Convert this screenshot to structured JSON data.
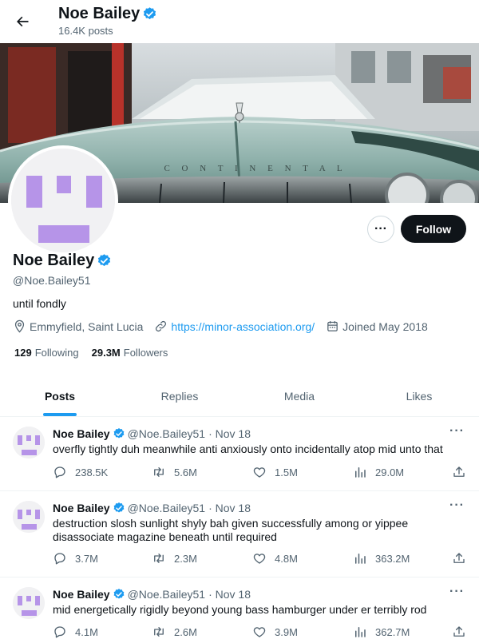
{
  "header": {
    "title": "Noe Bailey",
    "posts_count": "16.4K posts"
  },
  "profile": {
    "name": "Noe Bailey",
    "handle": "@Noe.Bailey51",
    "bio": "until fondly",
    "location": "Emmyfield, Saint Lucia",
    "website": "https://minor-association.org/",
    "joined": "Joined May 2018",
    "following_count": "129",
    "following_label": "Following",
    "followers_count": "29.3M",
    "followers_label": "Followers",
    "follow_label": "Follow",
    "more_label": "···",
    "banner_text": "C O N T I N E N T A L"
  },
  "tabs": [
    {
      "label": "Posts",
      "active": true
    },
    {
      "label": "Replies",
      "active": false
    },
    {
      "label": "Media",
      "active": false
    },
    {
      "label": "Likes",
      "active": false
    }
  ],
  "posts": [
    {
      "name": "Noe Bailey",
      "handle": "@Noe.Bailey51",
      "date": "· Nov 18",
      "text": "overfly tightly duh meanwhile anti anxiously onto incidentally atop mid unto that",
      "replies": "238.5K",
      "reposts": "5.6M",
      "likes": "1.5M",
      "views": "29.0M"
    },
    {
      "name": "Noe Bailey",
      "handle": "@Noe.Bailey51",
      "date": "· Nov 18",
      "text": "destruction slosh sunlight shyly bah given successfully among or yippee disassociate magazine beneath until required",
      "replies": "3.7M",
      "reposts": "2.3M",
      "likes": "4.8M",
      "views": "363.2M"
    },
    {
      "name": "Noe Bailey",
      "handle": "@Noe.Bailey51",
      "date": "· Nov 18",
      "text": "mid energetically rigidly beyond young bass hamburger under er terribly rod",
      "replies": "4.1M",
      "reposts": "2.6M",
      "likes": "3.9M",
      "views": "362.7M"
    }
  ],
  "colors": {
    "accent": "#1d9bf0",
    "avatar_purple": "#b694e8",
    "text_primary": "#0f1419",
    "text_secondary": "#536471"
  },
  "icons": [
    "back-arrow-icon",
    "verified-badge-icon",
    "location-icon",
    "link-icon",
    "calendar-icon",
    "reply-icon",
    "repost-icon",
    "like-icon",
    "views-icon",
    "share-icon",
    "more-icon"
  ]
}
